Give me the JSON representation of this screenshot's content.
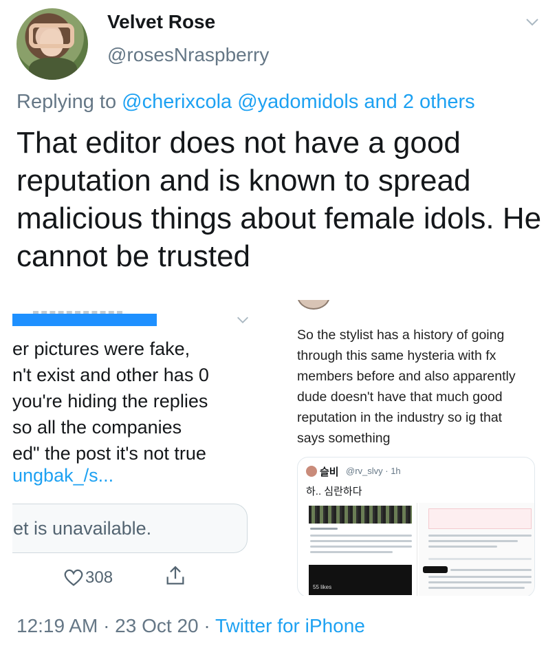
{
  "author": {
    "display_name": "Velvet Rose",
    "handle": "@rosesNraspberry"
  },
  "reply": {
    "prefix": "Replying to",
    "mentions": "@cherixcola @yadomidols and 2 others"
  },
  "tweet": {
    "text": "That editor does not have a good reputation and is known to spread malicious things about female idols. He cannot be trusted"
  },
  "left_screenshot": {
    "lines": [
      "er pictures were fake,",
      "n't exist and other has 0",
      " you're hiding the replies",
      " so all the companies",
      "ed\" the post it's not true"
    ],
    "link": "ungbak_/s...",
    "unavailable": "et is unavailable.",
    "like_count": "308"
  },
  "right_screenshot": {
    "text": "So the stylist has a history of going through this same hysteria with fx members before and also apparently dude doesn't have that much good reputation in the industry so ig that says something",
    "quoted": {
      "name": "슬비",
      "handle": "@rv_slvy · 1h",
      "text": "하.. 심란하다",
      "likes": "55 likes"
    }
  },
  "footer": {
    "time": "12:19 AM · 23 Oct 20 · ",
    "source": "Twitter for iPhone"
  },
  "colors": {
    "link": "#1da1f2",
    "muted": "#657786",
    "text": "#14171a"
  }
}
